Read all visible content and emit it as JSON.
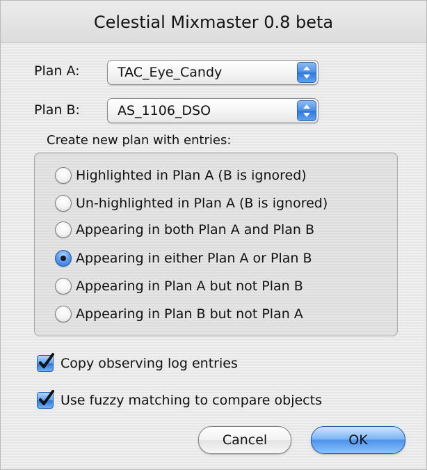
{
  "window": {
    "title": "Celestial Mixmaster 0.8 beta"
  },
  "plan_a": {
    "label": "Plan A:",
    "selected": "TAC_Eye_Candy"
  },
  "plan_b": {
    "label": "Plan B:",
    "selected": "AS_1106_DSO"
  },
  "entries": {
    "label": "Create new plan with entries:",
    "options": [
      {
        "label": "Highlighted in Plan A (B is ignored)",
        "selected": false
      },
      {
        "label": "Un-highlighted in Plan A (B is ignored)",
        "selected": false
      },
      {
        "label": "Appearing in both Plan A and Plan B",
        "selected": false
      },
      {
        "label": "Appearing in either Plan A or Plan B",
        "selected": true
      },
      {
        "label": "Appearing in Plan A but not Plan B",
        "selected": false
      },
      {
        "label": "Appearing in Plan B but not Plan A",
        "selected": false
      }
    ]
  },
  "options": {
    "copy_log": {
      "label": "Copy observing log entries",
      "checked": true
    },
    "fuzzy": {
      "label": "Use fuzzy matching to compare objects",
      "checked": true
    }
  },
  "buttons": {
    "cancel": "Cancel",
    "ok": "OK"
  },
  "colors": {
    "accent": "#4d92ea",
    "background": "#ececec"
  },
  "icons": {
    "popup": "up-down-arrows-icon",
    "check": "checkmark-icon"
  }
}
